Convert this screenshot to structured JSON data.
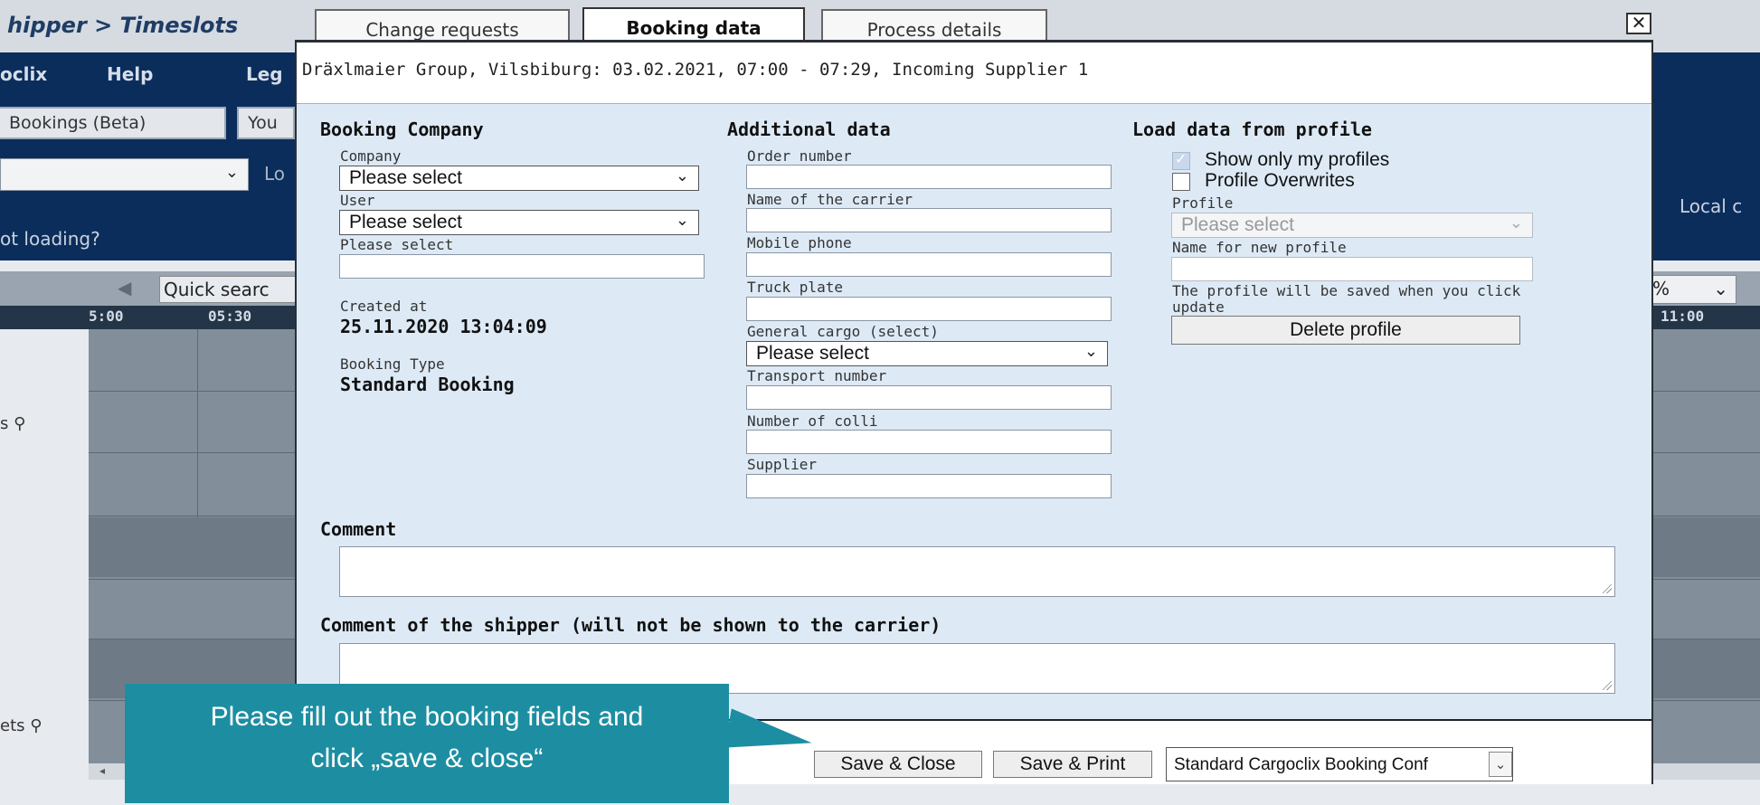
{
  "background": {
    "app_title": "hipper > Timeslots",
    "menu": [
      "oclix",
      "Help",
      "Leg"
    ],
    "tabs": [
      "Bookings (Beta)",
      "You"
    ],
    "filter_label": "Lo",
    "loading_text": "ot loading?",
    "local_text": "Local c",
    "quick_search": "Quick searc",
    "zoom_text": "%",
    "times": [
      "5:00",
      "05:30",
      "11:00"
    ],
    "row_labels": [
      "s",
      "ets"
    ]
  },
  "modal": {
    "tabs": [
      "Change requests",
      "Booking data",
      "Process details"
    ],
    "active_tab": "Booking data",
    "header": "Dräxlmaier Group, Vilsbiburg: 03.02.2021, 07:00 - 07:29, Incoming Supplier 1",
    "booking_company": {
      "title": "Booking Company",
      "company_label": "Company",
      "company_value": "Please select",
      "user_label": "User",
      "user_value": "Please select",
      "extra_label": "Please select",
      "created_at_label": "Created at",
      "created_at_value": "25.11.2020 13:04:09",
      "booking_type_label": "Booking Type",
      "booking_type_value": "Standard Booking"
    },
    "additional_data": {
      "title": "Additional data",
      "order_number": "Order number",
      "carrier_name": "Name of the carrier",
      "mobile_phone": "Mobile phone",
      "truck_plate": "Truck plate",
      "general_cargo_label": "General cargo (select)",
      "general_cargo_value": "Please select",
      "transport_number": "Transport number",
      "number_of_colli": "Number of colli",
      "supplier": "Supplier"
    },
    "load_profile": {
      "title": "Load data from profile",
      "show_only_my_profiles": "Show only my profiles",
      "show_only_checked": true,
      "profile_overwrites": "Profile Overwrites",
      "profile_overwrites_checked": false,
      "profile_label": "Profile",
      "profile_value": "Please select",
      "new_profile_label": "Name for new profile",
      "note_line1": "The profile will be saved when you click",
      "note_line2": "update",
      "delete_button": "Delete profile"
    },
    "comment_label": "Comment",
    "shipper_comment_label": "Comment of the shipper (will not be shown to the carrier)",
    "footer": {
      "save_close": "Save & Close",
      "save_print": "Save & Print",
      "print_template": "Standard Cargoclix Booking Conf"
    }
  },
  "callout": {
    "line1": "Please fill out the booking fields and",
    "line2": "click „save & close“"
  },
  "colors": {
    "nav_dark": "#0b2d5b",
    "modal_bg": "#ddeaf6",
    "callout": "#1d8ea2"
  }
}
